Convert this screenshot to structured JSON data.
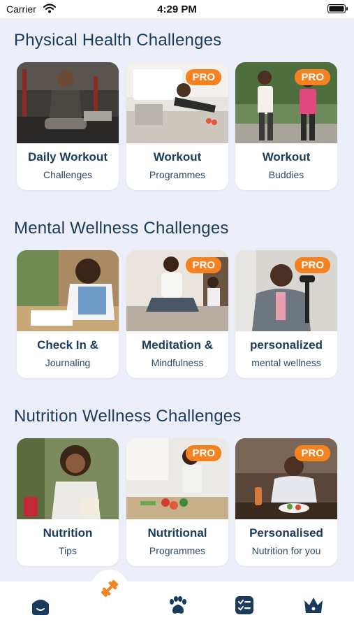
{
  "status_bar": {
    "carrier": "Carrier",
    "time": "4:29 PM"
  },
  "sections": [
    {
      "title": "Physical Health Challenges",
      "cards": [
        {
          "title": "Daily Workout",
          "subtitle": "Challenges",
          "pro": false
        },
        {
          "title": "Workout",
          "subtitle": "Programmes",
          "pro": true
        },
        {
          "title": "Workout",
          "subtitle": "Buddies",
          "pro": true
        }
      ]
    },
    {
      "title": "Mental Wellness Challenges",
      "cards": [
        {
          "title": "Check In &",
          "subtitle": "Journaling",
          "pro": false
        },
        {
          "title": "Meditation &",
          "subtitle": "Mindfulness",
          "pro": true
        },
        {
          "title": "personalized",
          "subtitle": "mental wellness",
          "pro": true
        }
      ]
    },
    {
      "title": "Nutrition Wellness Challenges",
      "cards": [
        {
          "title": "Nutrition",
          "subtitle": "Tips",
          "pro": false
        },
        {
          "title": "Nutritional",
          "subtitle": "Programmes",
          "pro": true
        },
        {
          "title": "Personalised",
          "subtitle": "Nutrition for you",
          "pro": true
        }
      ]
    }
  ],
  "pro_label": "PRO",
  "tabs": [
    {
      "icon": "home-icon"
    },
    {
      "icon": "dumbbell-icon",
      "active": true
    },
    {
      "icon": "paw-icon"
    },
    {
      "icon": "checklist-icon"
    },
    {
      "icon": "crown-icon"
    }
  ],
  "colors": {
    "accent": "#f58220",
    "primary": "#1b3b5c",
    "background": "#eceff9"
  }
}
